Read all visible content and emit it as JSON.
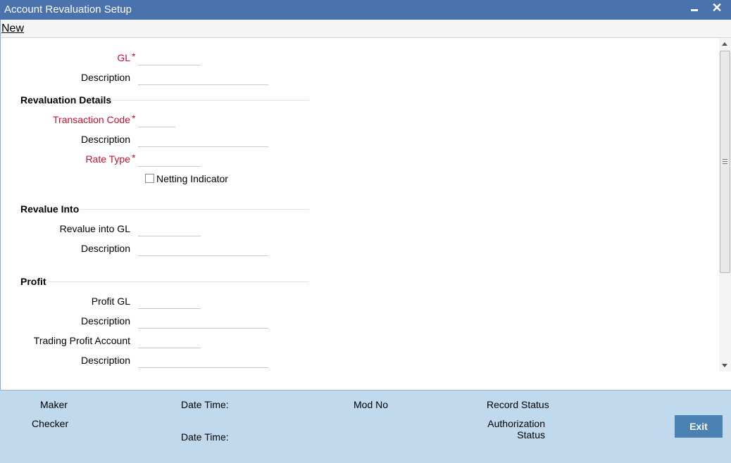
{
  "window": {
    "title": "Account Revaluation Setup",
    "minimize_icon": "minimize-icon",
    "close_glyph": "✕"
  },
  "menu": {
    "new_label": "New"
  },
  "form": {
    "gl_label": "GL",
    "gl_description_label": "Description",
    "required_marker": "*",
    "revaluation_details": {
      "heading": "Revaluation Details",
      "transaction_code_label": "Transaction Code",
      "description_label": "Description",
      "rate_type_label": "Rate Type",
      "netting_indicator_label": "Netting Indicator",
      "netting_checked": false
    },
    "revalue_into": {
      "heading": "Revalue Into",
      "revalue_into_gl_label": "Revalue into GL",
      "description_label": "Description"
    },
    "profit": {
      "heading": "Profit",
      "profit_gl_label": "Profit GL",
      "description_label": "Description",
      "trading_profit_account_label": "Trading Profit Account",
      "trading_description_label": "Description"
    }
  },
  "footer": {
    "maker_label": "Maker",
    "checker_label": "Checker",
    "date_time_label_1": "Date Time:",
    "date_time_label_2": "Date Time:",
    "mod_no_label": "Mod No",
    "record_status_label": "Record Status",
    "authorization_label_line1": "Authorization",
    "authorization_label_line2": "Status",
    "exit_label": "Exit"
  },
  "colors": {
    "title_bar": "#4a72ad",
    "required": "#c8102e",
    "footer_bg": "#c1d9ed",
    "exit_button": "#4a82b4"
  }
}
